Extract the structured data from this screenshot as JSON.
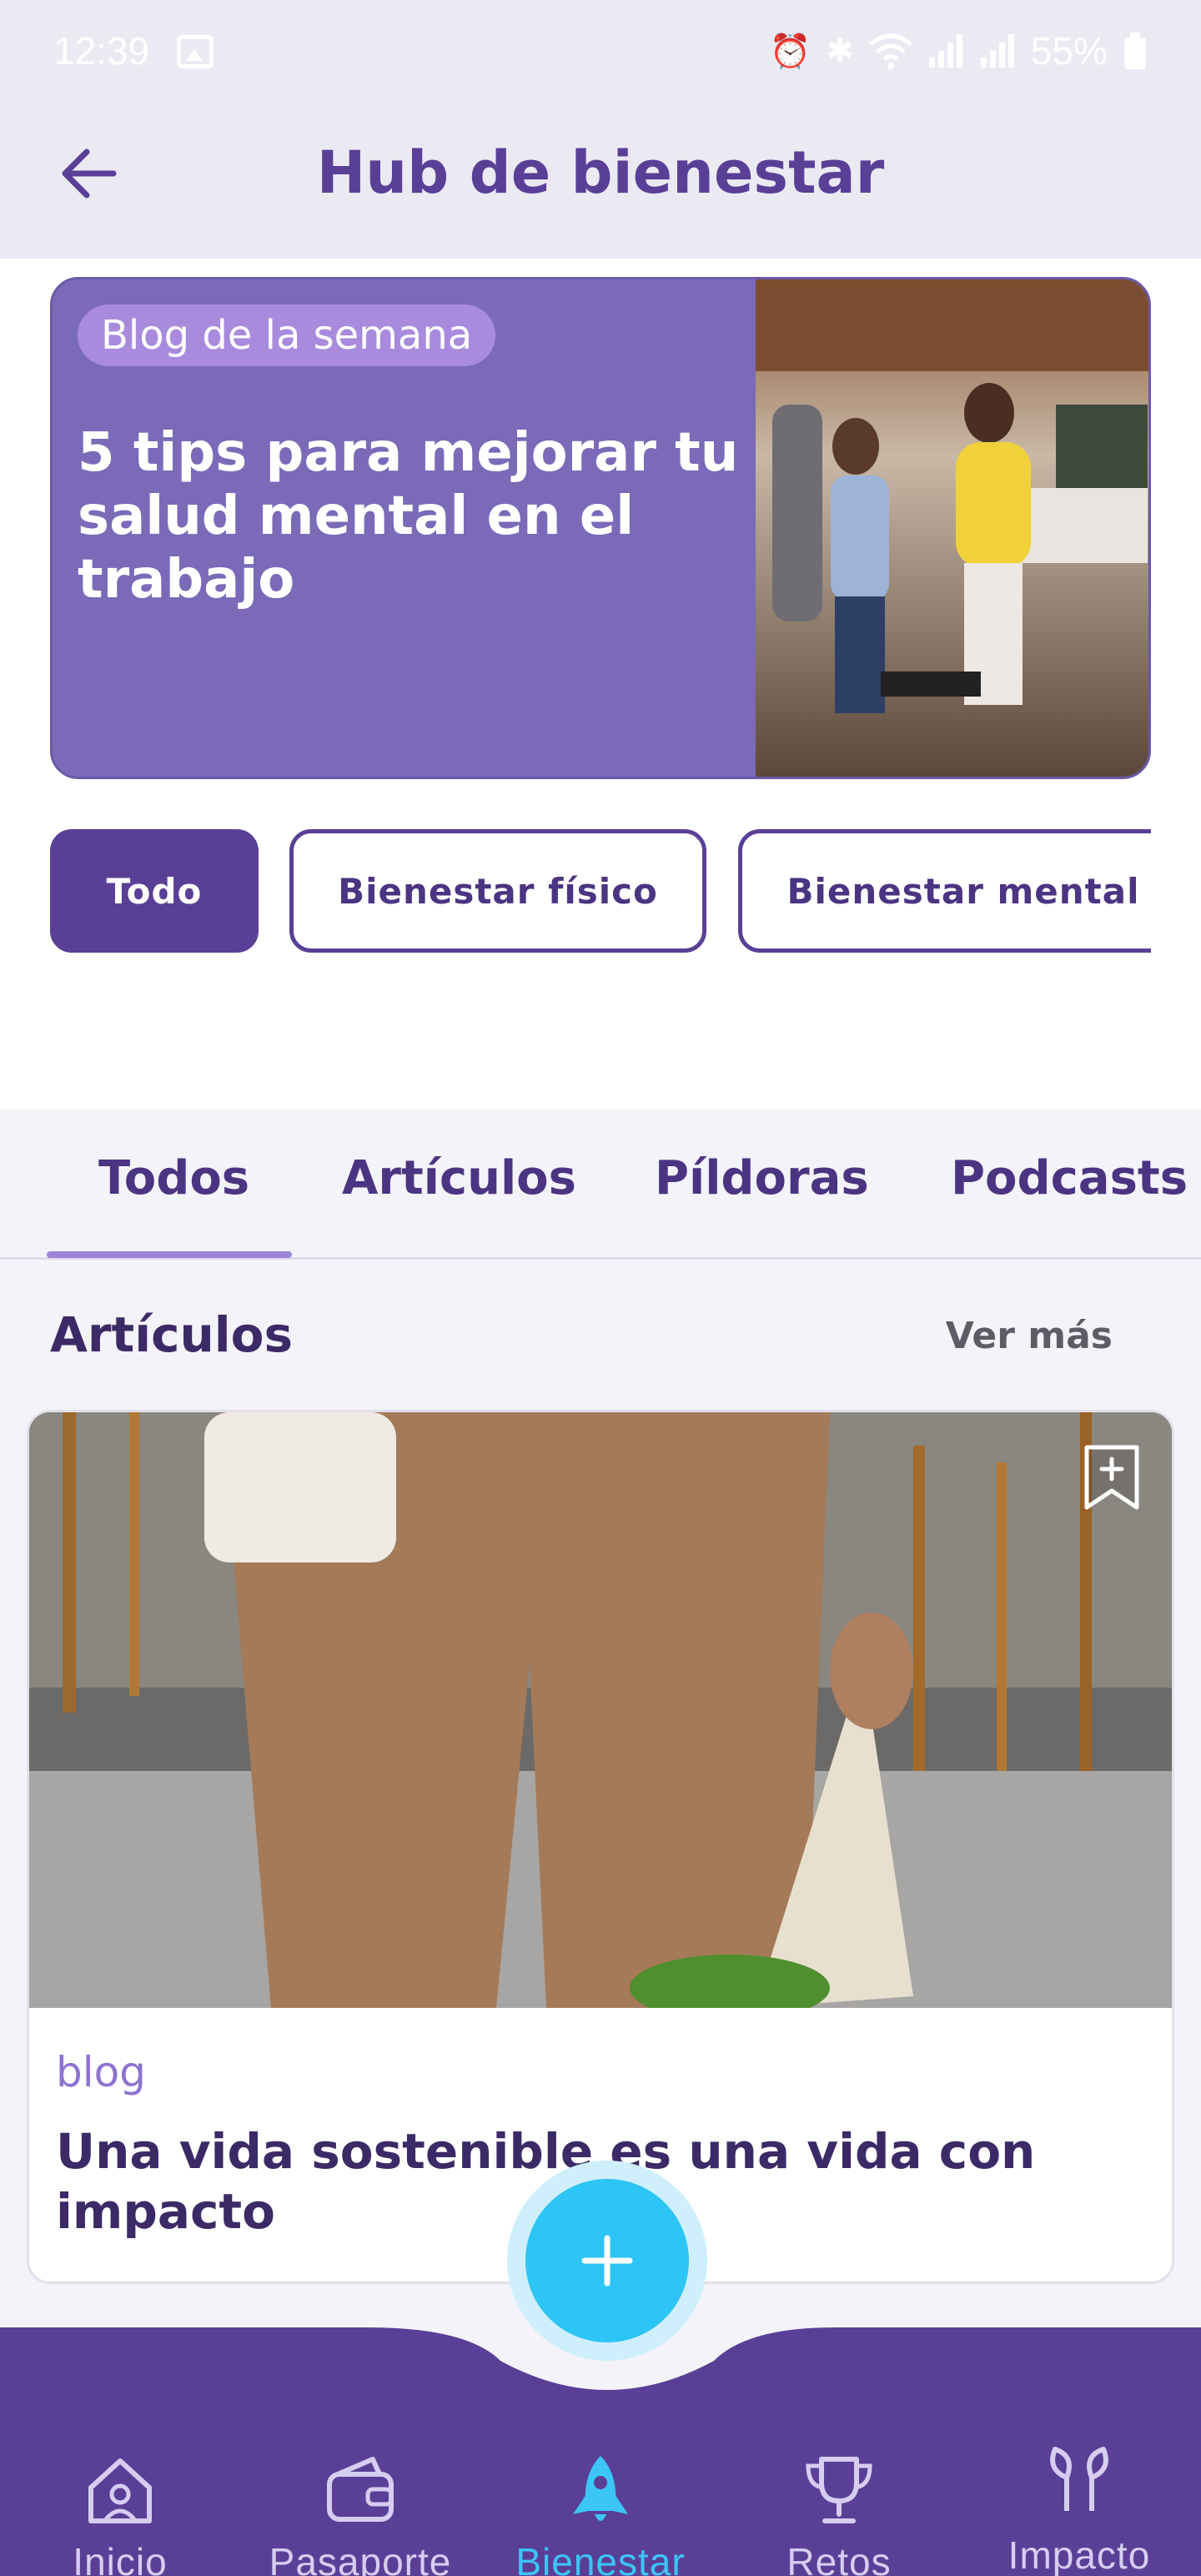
{
  "status_bar": {
    "time": "12:39",
    "battery": "55%"
  },
  "header": {
    "title": "Hub de bienestar",
    "back_icon": "arrow-left-icon"
  },
  "featured": {
    "badge": "Blog de la semana",
    "title": "5 tips para mejorar tu salud mental en el trabajo"
  },
  "filters": [
    {
      "label": "Todo",
      "active": true
    },
    {
      "label": "Bienestar físico",
      "active": false
    },
    {
      "label": "Bienestar mental",
      "active": false
    }
  ],
  "tabs": [
    {
      "label": "Todos",
      "active": true
    },
    {
      "label": "Artículos",
      "active": false
    },
    {
      "label": "Píldoras",
      "active": false
    },
    {
      "label": "Podcasts",
      "active": false
    }
  ],
  "section": {
    "title": "Artículos",
    "see_more": "Ver más"
  },
  "article": {
    "tag": "blog",
    "title": "Una vida sostenible es una vida con impacto",
    "bookmark_icon": "bookmark-add-icon"
  },
  "fab": {
    "icon": "plus-icon"
  },
  "bottom_nav": [
    {
      "label": "Inicio",
      "icon": "home-icon",
      "active": false
    },
    {
      "label": "Pasaporte",
      "icon": "wallet-icon",
      "active": false
    },
    {
      "label": "Bienestar",
      "icon": "rocket-icon",
      "active": true
    },
    {
      "label": "Retos",
      "icon": "trophy-icon",
      "active": false
    },
    {
      "label": "Impacto",
      "icon": "leaves-icon",
      "active": false
    }
  ],
  "colors": {
    "primary": "#5A3F97",
    "hero_bg": "#7A6AB8",
    "accent": "#2DC5F5",
    "nav_bg": "#5A3F97"
  }
}
